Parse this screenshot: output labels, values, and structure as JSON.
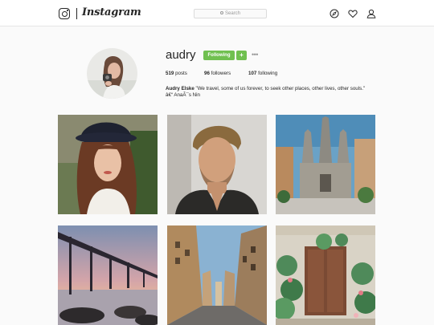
{
  "nav": {
    "logo_icon": "instagram-camera-icon",
    "wordmark": "Instagram",
    "search_placeholder": "Search",
    "icons": [
      "explore-compass-icon",
      "activity-heart-icon",
      "profile-person-icon"
    ]
  },
  "profile": {
    "username": "audry",
    "following_label": "Following",
    "plus_label": "+",
    "more_label": "•••",
    "stats": {
      "posts": {
        "count": "519",
        "label": "posts"
      },
      "followers": {
        "count": "96",
        "label": "followers"
      },
      "following": {
        "count": "107",
        "label": "following"
      }
    },
    "bio": {
      "name": "Audry Elske",
      "quote": "\"We travel, some of us forever, to seek other places, other lives, other souls.\"",
      "attribution": "â€“ AnaÃ¯s Nin"
    }
  },
  "posts": [
    {
      "subject": "woman-in-hat-portrait"
    },
    {
      "subject": "man-portrait"
    },
    {
      "subject": "gothic-cathedral"
    },
    {
      "subject": "pier-at-sunset"
    },
    {
      "subject": "city-street"
    },
    {
      "subject": "flower-covered-door"
    }
  ],
  "colors": {
    "follow_green": "#70c050",
    "background": "#fafafa",
    "border": "#e6e6e6"
  }
}
